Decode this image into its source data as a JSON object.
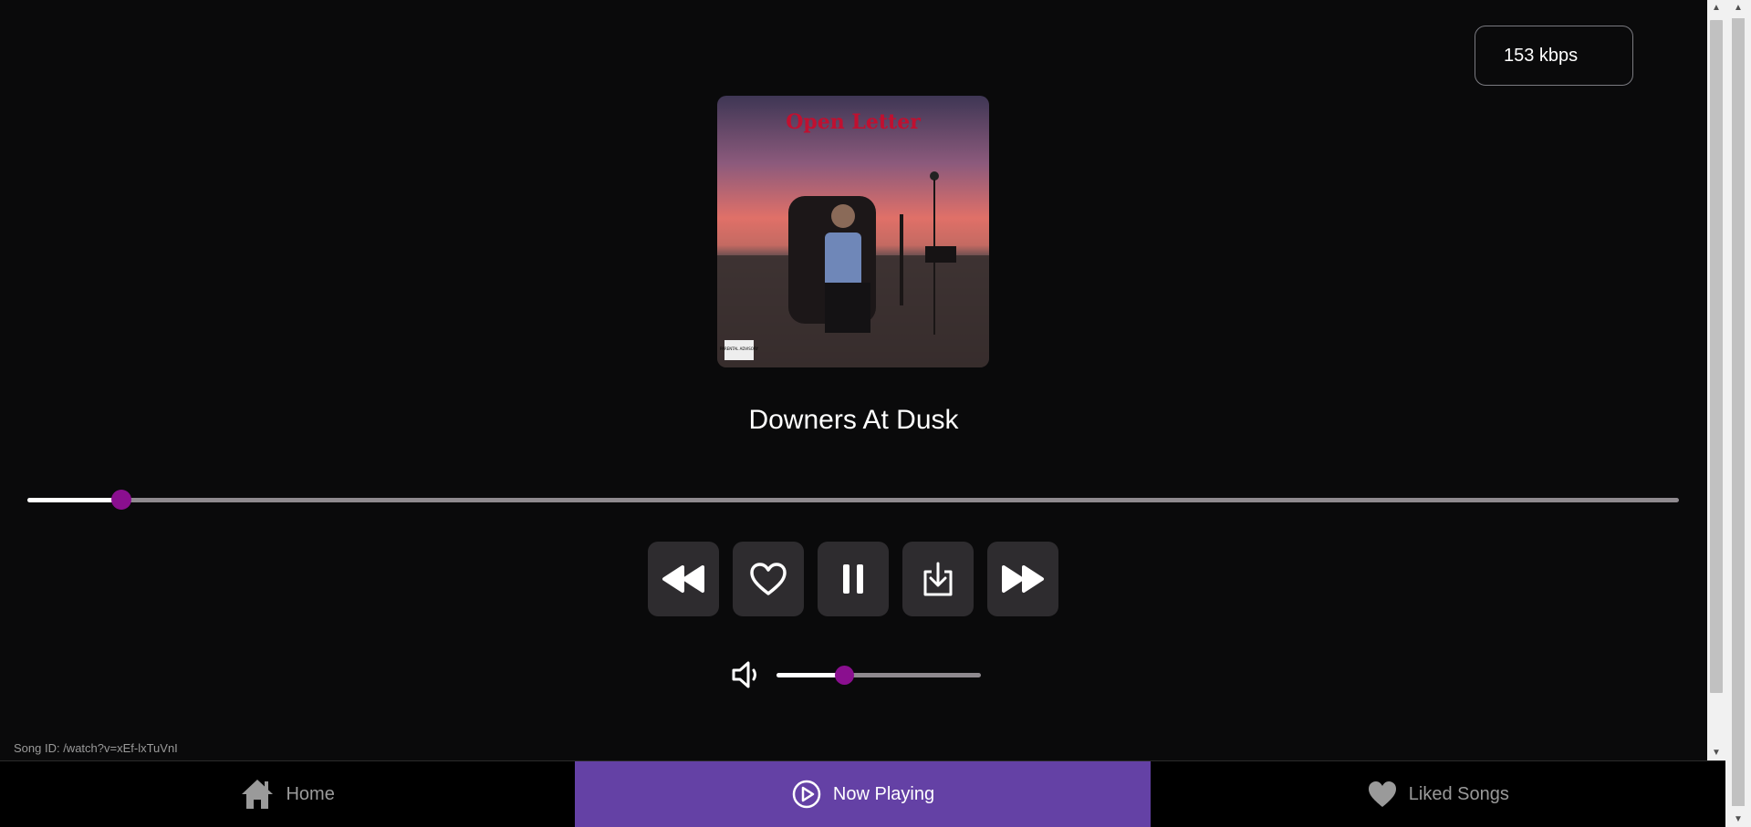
{
  "player": {
    "bitrate": "153 kbps",
    "album_art": {
      "title_text": "Open Letter",
      "advisory": "PARENTAL ADVISORY"
    },
    "song_title": "Downers At Dusk",
    "seek_progress": 0.057,
    "volume_level": 0.33,
    "song_id": "Song ID: /watch?v=xEf-lxTuVnI"
  },
  "controls": [
    {
      "name": "rewind-button",
      "icon": "rewind-icon"
    },
    {
      "name": "like-button",
      "icon": "heart-outline-icon"
    },
    {
      "name": "pause-button",
      "icon": "pause-icon"
    },
    {
      "name": "download-button",
      "icon": "download-icon"
    },
    {
      "name": "fast-forward-button",
      "icon": "fast-forward-icon"
    }
  ],
  "nav": [
    {
      "label": "Home",
      "icon": "home-icon"
    },
    {
      "label": "Now Playing",
      "icon": "play-circle-icon",
      "active": true
    },
    {
      "label": "Liked Songs",
      "icon": "heart-icon"
    }
  ],
  "colors": {
    "accent": "#8a0f8f",
    "nav_active": "#6441a5",
    "button_bg": "#2e2c2f"
  }
}
